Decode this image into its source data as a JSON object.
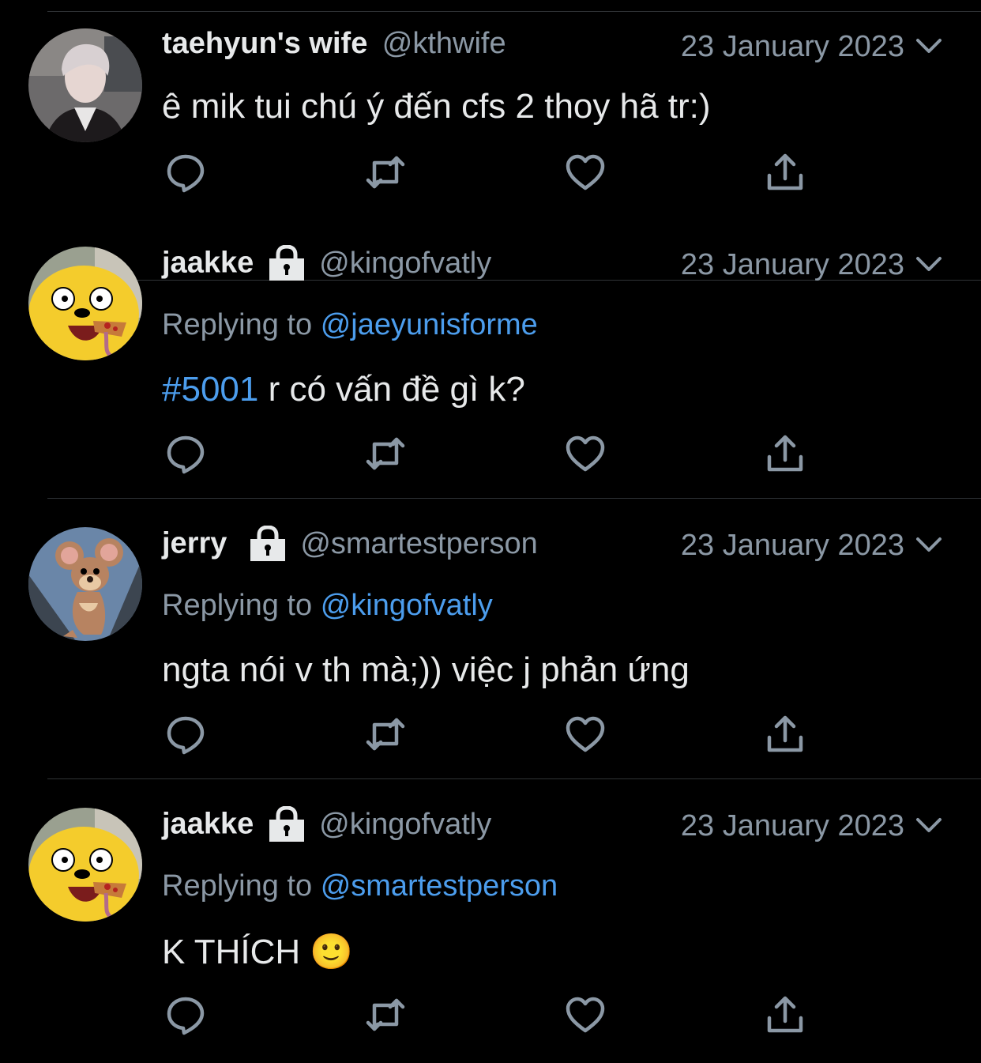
{
  "tweets": [
    {
      "name": "taehyun's wife",
      "locked": false,
      "handle": "@kthwife",
      "date": "23 January 2023",
      "replying_label": "",
      "replying_to": "",
      "hashtag": "",
      "body": "ê mik tui chú ý đến cfs 2 thoy hã tr:)",
      "avatar": "boy-photo"
    },
    {
      "name": "jaakke",
      "locked": true,
      "handle": "@kingofvatly",
      "date": "23 January 2023",
      "replying_label": "Replying to",
      "replying_to": "@jaeyunisforme",
      "hashtag": "#5001",
      "body": " r có vấn đề gì k?",
      "avatar": "jake-dog"
    },
    {
      "name": "jerry",
      "locked": true,
      "handle": "@smartestperson",
      "date": "23 January 2023",
      "replying_label": "Replying to",
      "replying_to": "@kingofvatly",
      "hashtag": "",
      "body": "ngta nói v th mà;)) việc j phản ứng",
      "avatar": "jerry-mouse"
    },
    {
      "name": "jaakke",
      "locked": true,
      "handle": "@kingofvatly",
      "date": "23 January 2023",
      "replying_label": "Replying to",
      "replying_to": "@smartestperson",
      "hashtag": "",
      "body": "K THÍCH 🙂",
      "avatar": "jake-dog"
    }
  ],
  "icons": {
    "reply": "reply-icon",
    "retweet": "retweet-icon",
    "like": "heart-icon",
    "share": "share-icon",
    "lock": "lock-icon",
    "more": "chevron-down-icon"
  },
  "colors": {
    "background": "#000000",
    "text": "#e7e9ea",
    "muted": "#8b98a5",
    "link": "#4c9ded",
    "divider": "#2f3336"
  }
}
